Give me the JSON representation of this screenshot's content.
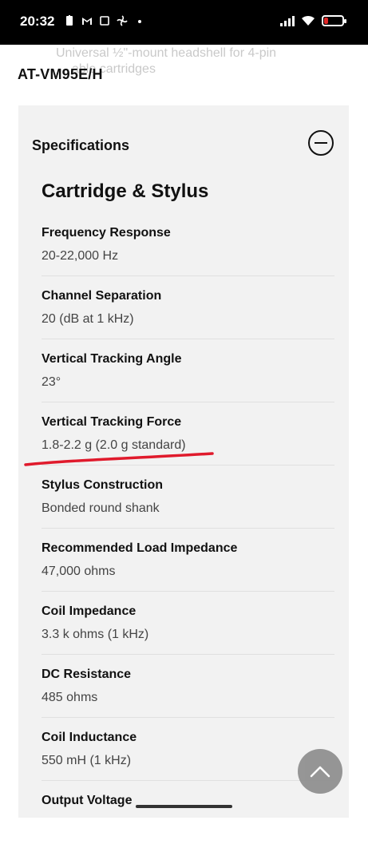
{
  "status": {
    "time": "20:32",
    "battery_color": "#e02828"
  },
  "header": {
    "ghost_line1": "Universal ½\"-mount headshell for 4-pin",
    "ghost_line2": "able cartridges",
    "title": "AT-VM95E/H"
  },
  "specs": {
    "header_label": "Specifications",
    "section_title": "Cartridge & Stylus",
    "items": [
      {
        "label": "Frequency Response",
        "value": "20-22,000 Hz"
      },
      {
        "label": "Channel Separation",
        "value": "20 (dB at 1 kHz)"
      },
      {
        "label": "Vertical Tracking Angle",
        "value": "23°"
      },
      {
        "label": "Vertical Tracking Force",
        "value": "1.8-2.2 g (2.0 g standard)"
      },
      {
        "label": "Stylus Construction",
        "value": "Bonded round shank"
      },
      {
        "label": "Recommended Load Impedance",
        "value": "47,000 ohms"
      },
      {
        "label": "Coil Impedance",
        "value": "3.3 k ohms (1 kHz)"
      },
      {
        "label": "DC Resistance",
        "value": "485 ohms"
      },
      {
        "label": "Coil Inductance",
        "value": "550 mH (1 kHz)"
      },
      {
        "label": "Output Voltage",
        "value": ""
      }
    ]
  },
  "annotation": {
    "underline_color": "#e01a2c"
  }
}
